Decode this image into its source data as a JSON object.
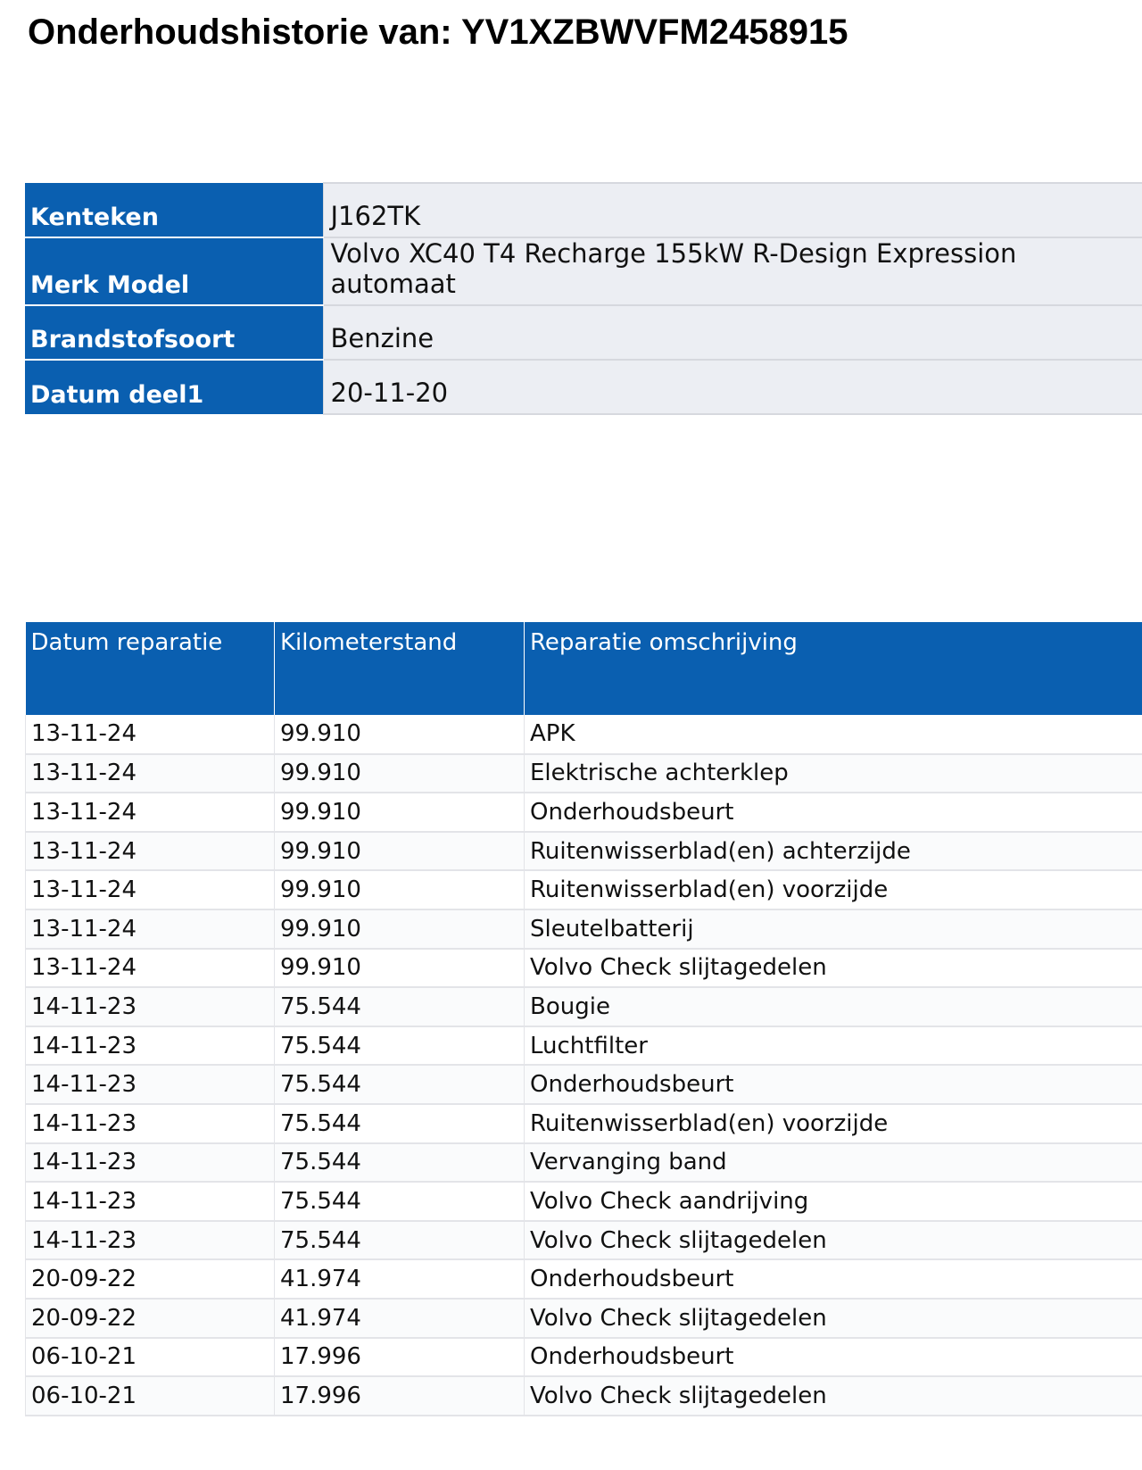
{
  "title": "Onderhoudshistorie van: YV1XZBWVFM2458915",
  "vehicle": [
    {
      "label": "Kenteken",
      "value": "J162TK"
    },
    {
      "label": "Merk Model",
      "value": "Volvo XC40 T4 Recharge 155kW R-Design Expression automaat"
    },
    {
      "label": "Brandstofsoort",
      "value": "Benzine"
    },
    {
      "label": "Datum deel1",
      "value": "20-11-20"
    }
  ],
  "repairs": {
    "headers": [
      "Datum reparatie",
      "Kilometerstand",
      "Reparatie omschrijving"
    ],
    "rows": [
      [
        "13-11-24",
        "99.910",
        "APK"
      ],
      [
        "13-11-24",
        "99.910",
        "Elektrische achterklep"
      ],
      [
        "13-11-24",
        "99.910",
        "Onderhoudsbeurt"
      ],
      [
        "13-11-24",
        "99.910",
        "Ruitenwisserblad(en) achterzijde"
      ],
      [
        "13-11-24",
        "99.910",
        "Ruitenwisserblad(en) voorzijde"
      ],
      [
        "13-11-24",
        "99.910",
        "Sleutelbatterij"
      ],
      [
        "13-11-24",
        "99.910",
        "Volvo Check slijtagedelen"
      ],
      [
        "14-11-23",
        "75.544",
        "Bougie"
      ],
      [
        "14-11-23",
        "75.544",
        "Luchtfilter"
      ],
      [
        "14-11-23",
        "75.544",
        "Onderhoudsbeurt"
      ],
      [
        "14-11-23",
        "75.544",
        "Ruitenwisserblad(en) voorzijde"
      ],
      [
        "14-11-23",
        "75.544",
        "Vervanging band"
      ],
      [
        "14-11-23",
        "75.544",
        "Volvo Check aandrijving"
      ],
      [
        "14-11-23",
        "75.544",
        "Volvo Check slijtagedelen"
      ],
      [
        "20-09-22",
        "41.974",
        "Onderhoudsbeurt"
      ],
      [
        "20-09-22",
        "41.974",
        "Volvo Check slijtagedelen"
      ],
      [
        "06-10-21",
        "17.996",
        "Onderhoudsbeurt"
      ],
      [
        "06-10-21",
        "17.996",
        "Volvo Check slijtagedelen"
      ]
    ]
  },
  "colors": {
    "header_blue": "#0a5fb0",
    "value_bg": "#eceef3"
  }
}
